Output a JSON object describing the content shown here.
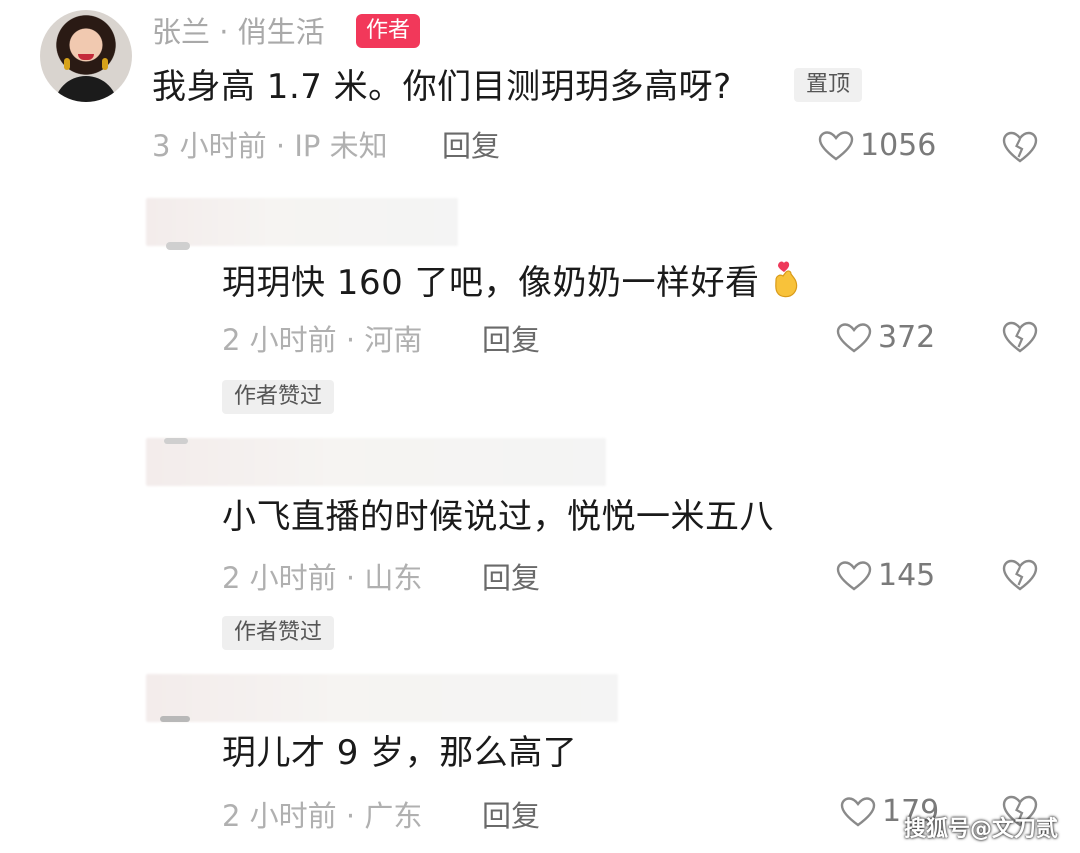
{
  "author_comment": {
    "name": "张兰 · 俏生活",
    "badge": "作者",
    "text": "我身高 1.7 米。你们目测玥玥多高呀?",
    "pin": "置顶",
    "meta": "3 小时前 · IP 未知",
    "reply": "回复",
    "likes": "1056"
  },
  "comments": [
    {
      "text": "玥玥快 160 了吧，像奶奶一样好看",
      "meta": "2 小时前 · 河南",
      "reply": "回复",
      "likes": "372",
      "liked_tag": "作者赞过"
    },
    {
      "text": "小飞直播的时候说过，悦悦一米五八",
      "meta": "2 小时前 · 山东",
      "reply": "回复",
      "likes": "145",
      "liked_tag": "作者赞过"
    },
    {
      "text": "玥儿才 9 岁，那么高了",
      "meta": "2 小时前 · 广东",
      "reply": "回复",
      "likes": "179"
    }
  ],
  "watermark": "搜狐号@文刀贰",
  "icons": [
    "heart-outline-icon",
    "heart-broken-icon",
    "finger-heart-emoji-icon"
  ],
  "colors": {
    "author_badge": "#f2385a",
    "meta_text": "#b0b0b0"
  }
}
